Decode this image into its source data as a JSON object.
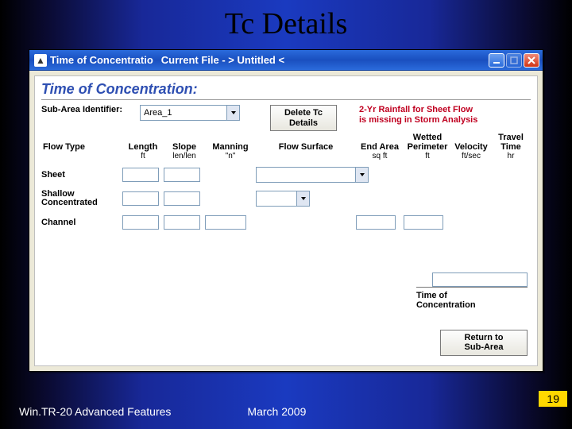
{
  "slide": {
    "title": "Tc Details",
    "footer_left": "Win.TR-20 Advanced Features",
    "footer_mid": "March 2009",
    "page_number": "19"
  },
  "window": {
    "title_left": "Time of Concentratio",
    "title_mid": "Current File - > Untitled <",
    "icon_glyph": "▲"
  },
  "panel": {
    "section_title": "Time of Concentration:",
    "sub_area_label": "Sub-Area Identifier:",
    "sub_area_value": "Area_1",
    "delete_button": "Delete Tc\nDetails",
    "warning_line1": "2-Yr Rainfall for Sheet Flow",
    "warning_line2": "is missing in Storm Analysis",
    "tc_label": "Time of\nConcentration",
    "return_button": "Return to\nSub-Area"
  },
  "columns": {
    "flow_type": "Flow Type",
    "length": "Length",
    "slope": "Slope",
    "manning": "Manning",
    "surface": "Flow Surface",
    "end_area": "End Area",
    "wetted_perim": "Wetted\nPerimeter",
    "velocity": "Velocity",
    "travel_time": "Travel\nTime"
  },
  "units": {
    "length": "ft",
    "slope": "len/len",
    "manning": "\"n\"",
    "end_area": "sq ft",
    "wetted_perim": "ft",
    "velocity": "ft/sec",
    "travel_time": "hr"
  },
  "row_types": {
    "sheet": "Sheet",
    "shallow": "Shallow\nConcentrated",
    "channel": "Channel"
  }
}
